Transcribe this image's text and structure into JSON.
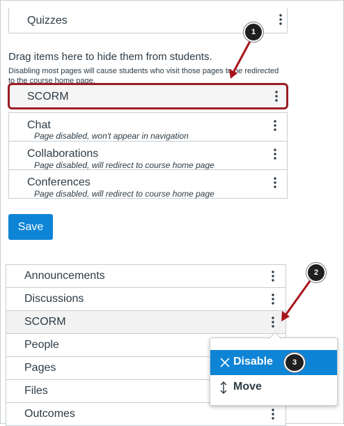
{
  "top_list": {
    "items": [
      {
        "label": "Quizzes"
      }
    ]
  },
  "hidden_section": {
    "title": "Drag items here to hide them from students.",
    "subtitle_line1": "Disabling most pages will cause students who visit those pages to be redirected",
    "subtitle_line2": "to the course home page.",
    "items": [
      {
        "label": "SCORM",
        "note": ""
      },
      {
        "label": "Chat",
        "note": "Page disabled, won't appear in navigation"
      },
      {
        "label": "Collaborations",
        "note": "Page disabled, will redirect to course home page"
      },
      {
        "label": "Conferences",
        "note": "Page disabled, will redirect to course home page"
      }
    ]
  },
  "save_label": "Save",
  "nav_list": {
    "items": [
      {
        "label": "Announcements"
      },
      {
        "label": "Discussions"
      },
      {
        "label": "SCORM"
      },
      {
        "label": "People"
      },
      {
        "label": "Pages"
      },
      {
        "label": "Files"
      },
      {
        "label": "Outcomes"
      }
    ]
  },
  "context_menu": {
    "disable_label": "Disable",
    "move_label": "Move"
  },
  "callouts": {
    "one": "1",
    "two": "2",
    "three": "3"
  },
  "colors": {
    "accent": "#0e84d6",
    "highlight_border": "#9b1c25",
    "arrow": "#a8141c"
  }
}
